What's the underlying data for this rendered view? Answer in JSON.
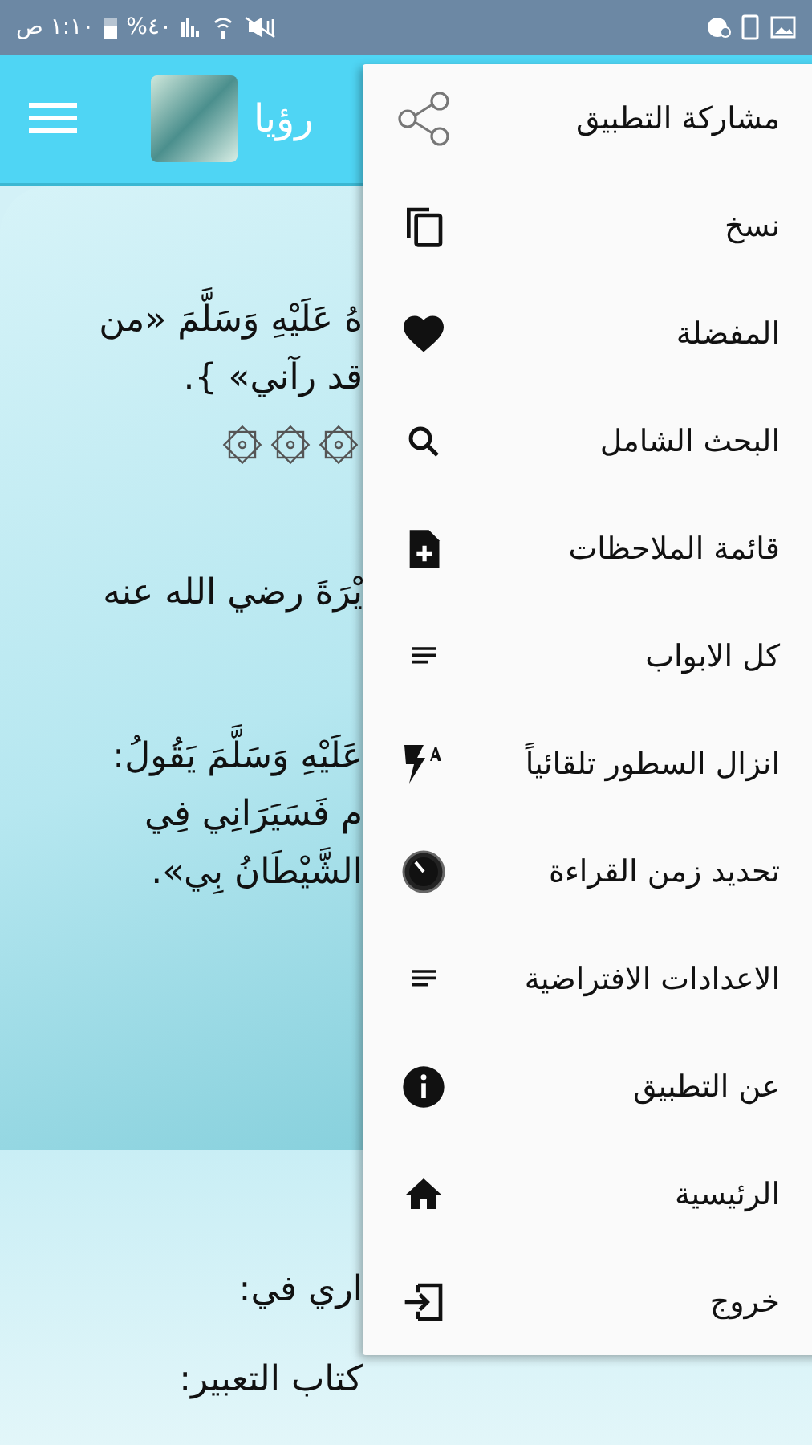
{
  "status_bar": {
    "time": "١:١٠ ص",
    "battery": "%٤٠"
  },
  "app_bar": {
    "title": "رؤيا"
  },
  "content": {
    "card": [
      {
        "kind": "text",
        "lines": [
          "هُ عَلَيْهِ وَسَلَّمَ «من",
          "قد رآني» }."
        ]
      },
      {
        "kind": "ornament"
      },
      {
        "kind": "text",
        "lines": [
          "يْرَةَ رضي الله عنه"
        ]
      },
      {
        "kind": "text",
        "lines": [
          "عَلَيْهِ وَسَلَّمَ يَقُولُ:",
          "م فَسَيَرَانِي فِي",
          "الشَّيْطَانُ بِي»."
        ]
      }
    ],
    "below": [
      {
        "kind": "text",
        "lines": [
          "اري في:",
          "كتاب التعبير:"
        ]
      }
    ]
  },
  "menu": {
    "items": [
      {
        "label": "مشاركة التطبيق"
      },
      {
        "label": "نسخ"
      },
      {
        "label": "المفضلة"
      },
      {
        "label": "البحث الشامل"
      },
      {
        "label": "قائمة الملاحظات"
      },
      {
        "label": "كل الابواب"
      },
      {
        "label": "انزال السطور تلقائياً"
      },
      {
        "label": "تحديد زمن القراءة"
      },
      {
        "label": "الاعدادات الافتراضية"
      },
      {
        "label": "عن التطبيق"
      },
      {
        "label": "الرئيسية"
      },
      {
        "label": "خروج"
      }
    ]
  }
}
